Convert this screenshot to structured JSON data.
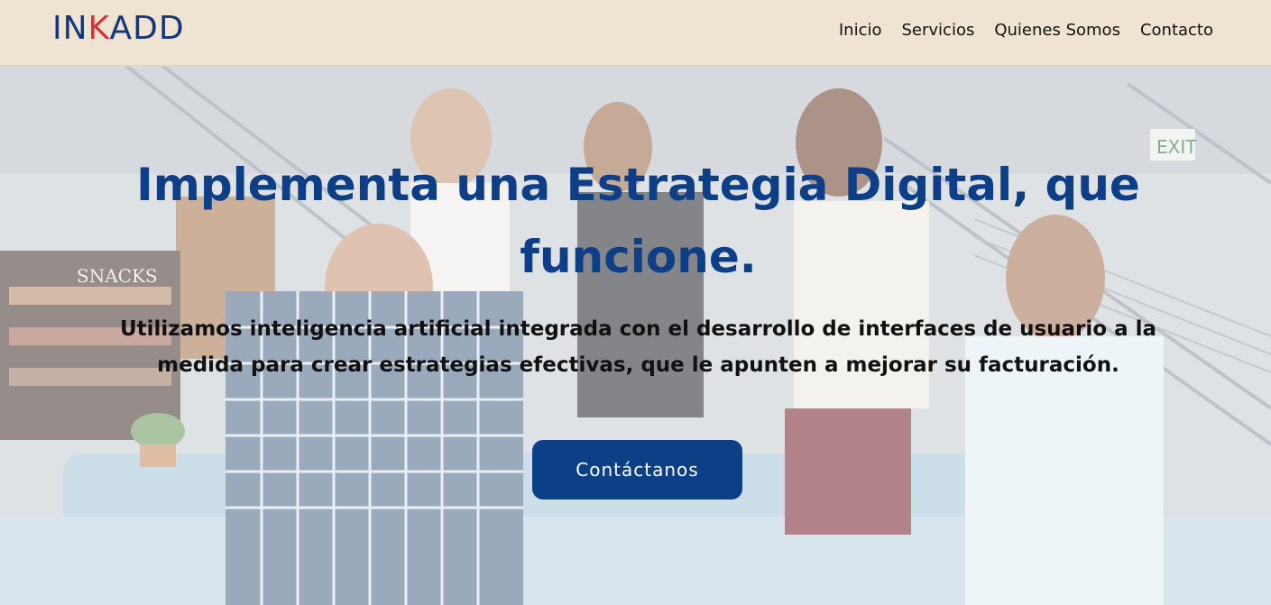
{
  "brand": {
    "logo_prefix": "IN",
    "logo_accent": "K",
    "logo_suffix": "ADD",
    "primary_color": "#16357a",
    "accent_color": "#d8303a"
  },
  "nav": {
    "items": [
      "Inicio",
      "Servicios",
      "Quienes Somos",
      "Contacto"
    ]
  },
  "hero": {
    "headline": "Implementa una Estrategia Digital, que funcione.",
    "subtext": "Utilizamos inteligencia artificial integrada con el desarrollo de interfaces de usuario a la medida para crear estrategias efectivas, que le apunten a mejorar su facturación.",
    "cta_label": "Contáctanos",
    "headline_color": "#0e3f86",
    "cta_color": "#0c3f85"
  }
}
